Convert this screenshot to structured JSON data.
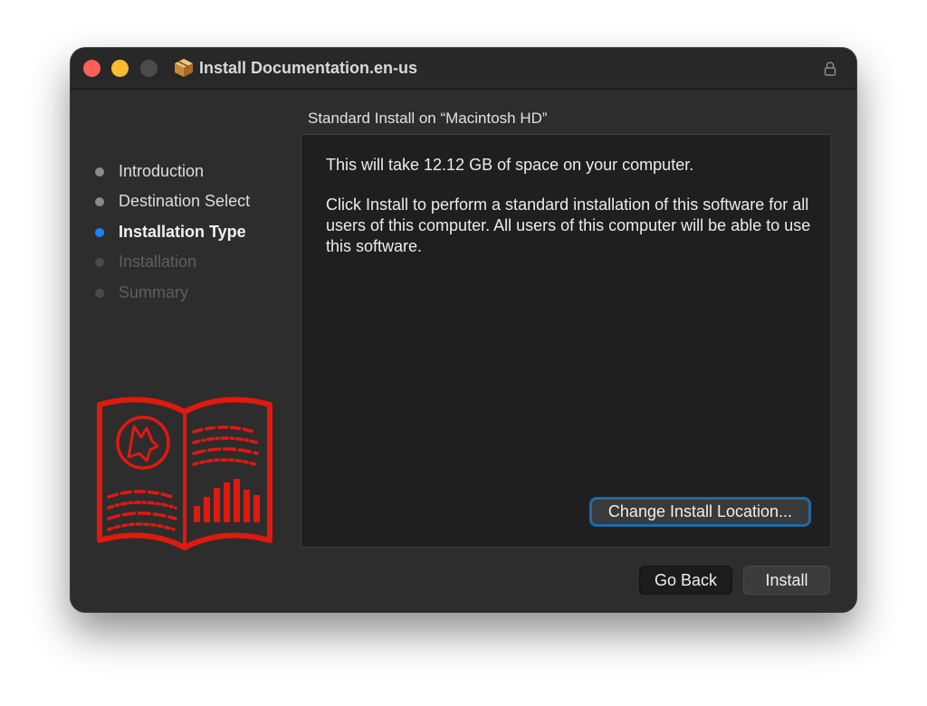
{
  "window": {
    "title": "Install Documentation.en-us",
    "icons": {
      "app": "package-icon",
      "lock": "lock-icon"
    },
    "traffic_lights": [
      "close",
      "minimize",
      "zoom"
    ]
  },
  "section_title": "Standard Install on “Macintosh HD”",
  "sidebar": {
    "steps": [
      {
        "label": "Introduction",
        "state": "done"
      },
      {
        "label": "Destination Select",
        "state": "done"
      },
      {
        "label": "Installation Type",
        "state": "current"
      },
      {
        "label": "Installation",
        "state": "future"
      },
      {
        "label": "Summary",
        "state": "future"
      }
    ],
    "illustration": "documentation-book-icon"
  },
  "content": {
    "space_text": "This will take 12.12 GB of space on your computer.",
    "description": "Click Install to perform a standard installation of this software for all users of this computer. All users of this computer will be able to use this software.",
    "change_location_label": "Change Install Location..."
  },
  "buttons": {
    "go_back": "Go Back",
    "install": "Install"
  },
  "colors": {
    "accent": "#1a82f7",
    "book_red": "#e0190f",
    "window_bg": "#2d2d2d",
    "content_bg": "#1f1f1f"
  }
}
